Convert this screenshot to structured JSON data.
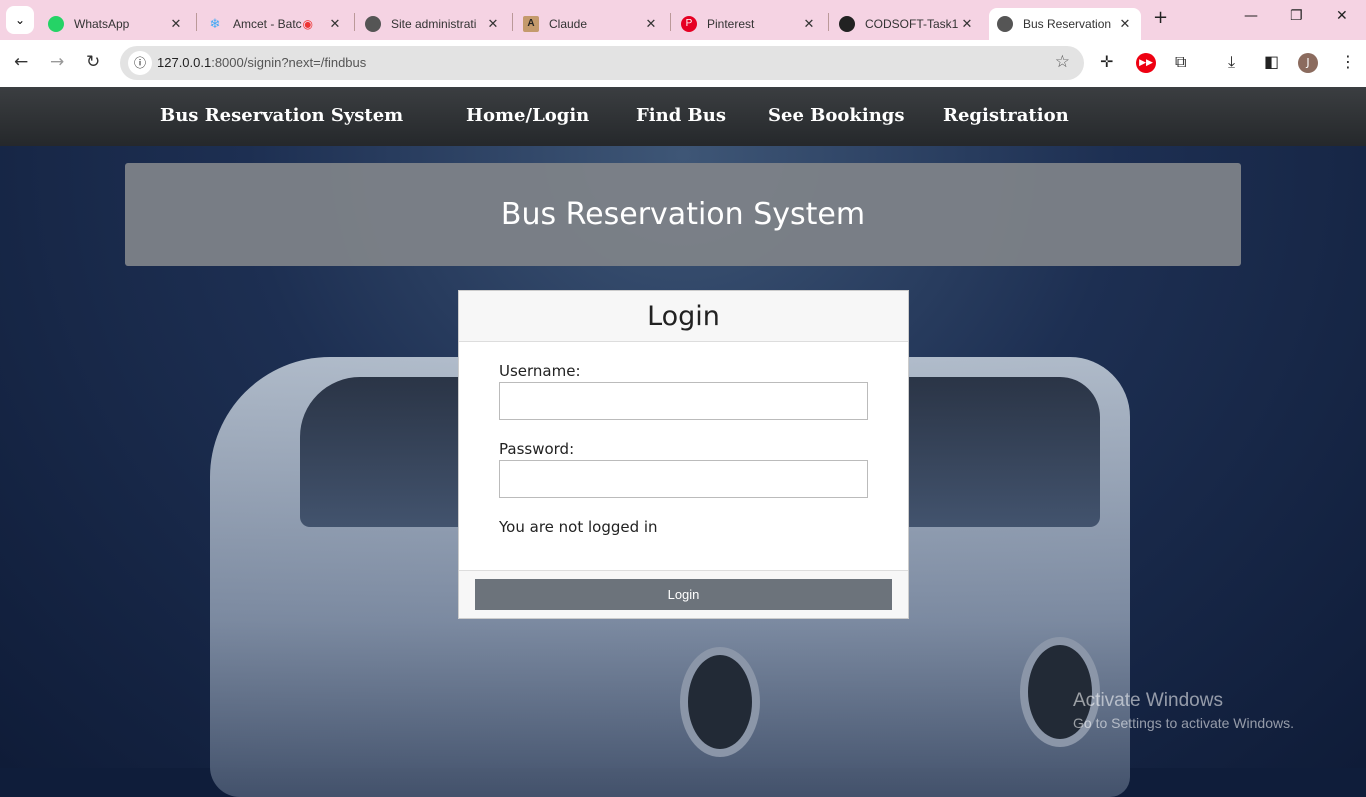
{
  "browser": {
    "tabs": [
      {
        "title": "WhatsApp",
        "icon": "whatsapp-icon",
        "color": "#25d366"
      },
      {
        "title": "Amcet - Batc",
        "icon": "react-icon",
        "color": "#61dafb"
      },
      {
        "title": "Site administrati",
        "icon": "globe-icon",
        "color": "#555555"
      },
      {
        "title": "Claude",
        "icon": "claude-icon",
        "color": "#c49a6c"
      },
      {
        "title": "Pinterest",
        "icon": "pinterest-icon",
        "color": "#e60023"
      },
      {
        "title": "CODSOFT-Task1",
        "icon": "github-icon",
        "color": "#222222"
      },
      {
        "title": "Bus Reservation",
        "icon": "globe-icon",
        "color": "#555555",
        "active": true
      }
    ],
    "url_host": "127.0.0.1",
    "url_rest": ":8000/signin?next=/findbus",
    "profile_initial": "J"
  },
  "nav": {
    "brand": "Bus Reservation System",
    "items": [
      "Home/Login",
      "Find Bus",
      "See Bookings",
      "Registration"
    ]
  },
  "banner": {
    "title": "Bus Reservation System"
  },
  "login": {
    "title": "Login",
    "username_label": "Username:",
    "username_value": "",
    "password_label": "Password:",
    "password_value": "",
    "status": "You are not logged in",
    "button": "Login"
  },
  "watermark": {
    "line1": "Activate Windows",
    "line2": "Go to Settings to activate Windows."
  }
}
